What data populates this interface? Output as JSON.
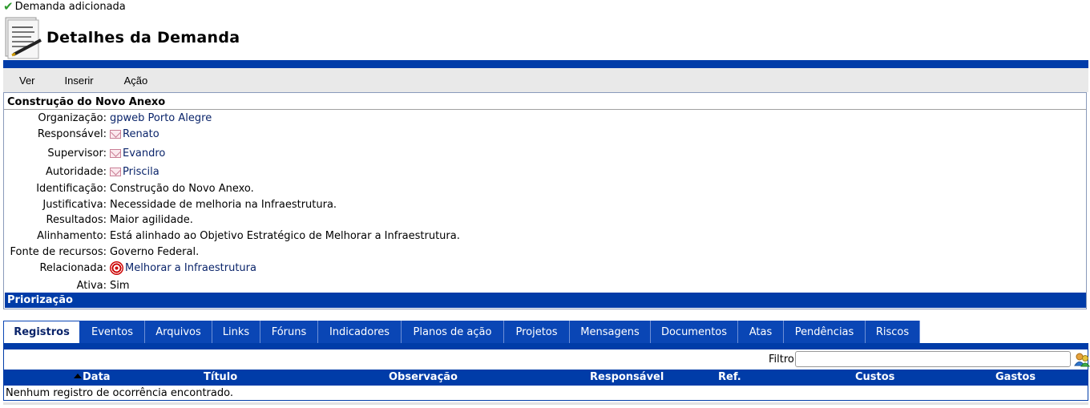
{
  "notice": {
    "text": "Demanda adicionada"
  },
  "header": {
    "title": "Detalhes da Demanda"
  },
  "menu": [
    "Ver",
    "Inserir",
    "Ação"
  ],
  "details": {
    "title": "Construção do Novo Anexo",
    "rows": [
      {
        "label": "Organização:",
        "value": "gpweb Porto Alegre",
        "icon": "",
        "link": true
      },
      {
        "label": "Responsável:",
        "value": "Renato",
        "icon": "mail-icon",
        "link": true
      },
      {
        "label": "Supervisor:",
        "value": "Evandro",
        "icon": "mail-icon",
        "link": true
      },
      {
        "label": "Autoridade:",
        "value": "Priscila",
        "icon": "mail-icon",
        "link": true
      },
      {
        "label": "Identificação:",
        "value": "Construção do Novo Anexo.",
        "icon": "",
        "link": false
      },
      {
        "label": "Justificativa:",
        "value": "Necessidade de melhoria na Infraestrutura.",
        "icon": "",
        "link": false
      },
      {
        "label": "Resultados:",
        "value": "Maior agilidade.",
        "icon": "",
        "link": false
      },
      {
        "label": "Alinhamento:",
        "value": "Está alinhado ao Objetivo Estratégico de Melhorar a Infraestrutura.",
        "icon": "",
        "link": false
      },
      {
        "label": "Fonte de recursos:",
        "value": "Governo Federal.",
        "icon": "",
        "link": false
      },
      {
        "label": "Relacionada:",
        "value": "Melhorar a Infraestrutura",
        "icon": "target-icon",
        "link": true
      },
      {
        "label": "Ativa:",
        "value": "Sim",
        "icon": "",
        "link": false
      }
    ],
    "priorization": "Priorização"
  },
  "tabs": [
    {
      "label": "Registros",
      "active": true
    },
    {
      "label": "Eventos"
    },
    {
      "label": "Arquivos"
    },
    {
      "label": "Links"
    },
    {
      "label": "Fóruns"
    },
    {
      "label": "Indicadores"
    },
    {
      "label": "Planos de ação"
    },
    {
      "label": "Projetos"
    },
    {
      "label": "Mensagens"
    },
    {
      "label": "Documentos"
    },
    {
      "label": "Atas"
    },
    {
      "label": "Pendências"
    },
    {
      "label": "Riscos"
    }
  ],
  "filter": {
    "label": "Filtro",
    "value": ""
  },
  "table": {
    "columns": [
      "Data",
      "Título",
      "Observação",
      "Responsável",
      "Ref.",
      "Custos",
      "Gastos"
    ],
    "empty": "Nenhum registro de ocorrência encontrado."
  },
  "colors": {
    "primary": "#003ca8",
    "tab": "#0a46b5",
    "menu_bg": "#e9e9e9"
  }
}
